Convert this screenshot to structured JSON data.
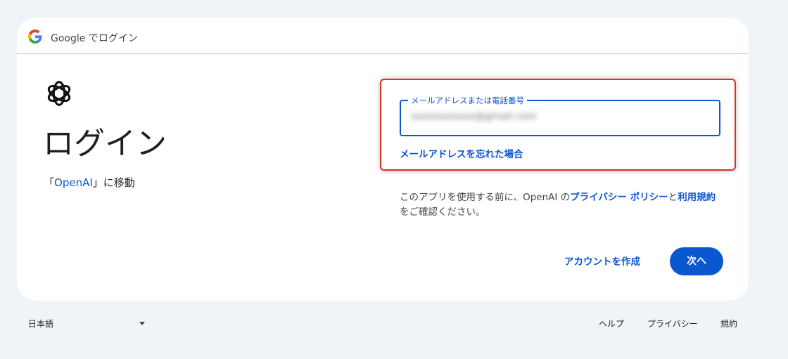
{
  "header": {
    "title": "Google でログイン",
    "logo_icon": "google-g-icon"
  },
  "app": {
    "logo_icon": "openai-logo-icon",
    "title": "ログイン",
    "subtitle_open": "「",
    "subtitle_link": "OpenAI",
    "subtitle_close": "」に移動"
  },
  "form": {
    "email_label": "メールアドレスまたは電話番号",
    "email_value": "xxxxxxxxxxx@gmail.com",
    "forgot_email": "メールアドレスを忘れた場合"
  },
  "notice": {
    "prefix": "このアプリを使用する前に、OpenAI の",
    "privacy_link": "プライバシー ポリシー",
    "middle": "と",
    "terms_link": "利用規約",
    "suffix": "をご確認ください。"
  },
  "actions": {
    "create_account": "アカウントを作成",
    "next": "次へ"
  },
  "footer": {
    "language": "日本語",
    "help": "ヘルプ",
    "privacy": "プライバシー",
    "terms": "規約"
  },
  "colors": {
    "accent": "#0b57d0",
    "highlight": "#d93025",
    "background": "#f0f4f9"
  }
}
